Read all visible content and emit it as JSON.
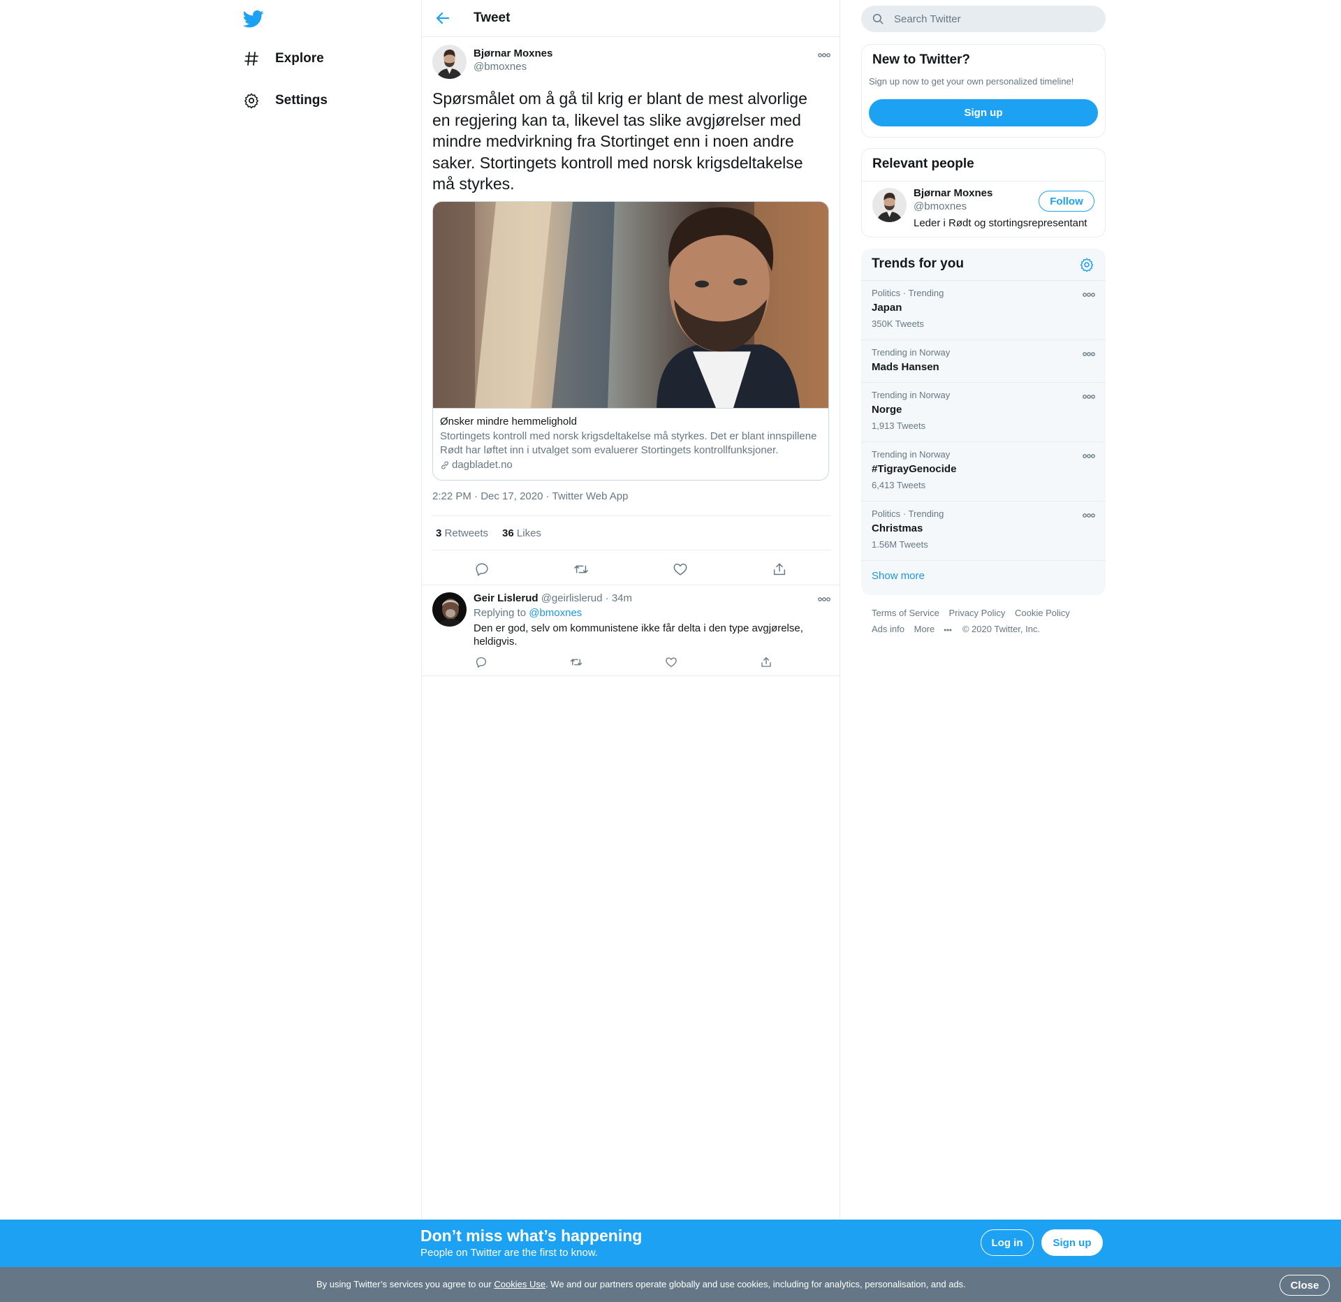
{
  "colors": {
    "brand": "#1da1f2",
    "link": "#1b95e0",
    "text": "#14171a",
    "secondary": "#657786",
    "border": "#e6ecf0",
    "cookie_bar": "#657786"
  },
  "nav": {
    "logo_icon": "twitter-bird-icon",
    "items": [
      {
        "label": "Explore",
        "icon": "hashtag-icon"
      },
      {
        "label": "Settings",
        "icon": "gear-icon"
      }
    ]
  },
  "header": {
    "title": "Tweet",
    "back_icon": "arrow-left-icon"
  },
  "tweet": {
    "author_name": "Bjørnar Moxnes",
    "author_handle": "@bmoxnes",
    "text": "Spørsmålet om å gå til krig er blant de mest alvorlige en regjering kan ta, likevel tas slike avgjørelser med mindre medvirkning fra Stortinget enn i noen andre saker. Stortingets kontroll med norsk krigsdeltakelse må styrkes.",
    "card": {
      "title": "Ønsker mindre hemmelighold",
      "description": "Stortingets kontroll med norsk krigsdeltakelse må styrkes. Det er blant innspillene Rødt har løftet inn i utvalget som evaluerer Stortingets kontrollfunksjoner.",
      "domain": "dagbladet.no"
    },
    "time": "2:22 PM",
    "date": "Dec 17, 2020",
    "source": "Twitter Web App",
    "sep": "·",
    "retweets_count": "3",
    "retweets_label": "Retweets",
    "likes_count": "36",
    "likes_label": "Likes"
  },
  "reply": {
    "author_name": "Geir Lislerud",
    "author_handle": "@geirlislerud",
    "sep": "·",
    "age": "34m",
    "replying_prefix": "Replying to",
    "replying_to": "@bmoxnes",
    "text": "Den er god, selv om kommunistene ikke får delta i den type avgjørelse, heldigvis."
  },
  "search": {
    "placeholder": "Search Twitter"
  },
  "new_to_twitter": {
    "title": "New to Twitter?",
    "subtitle": "Sign up now to get your own personalized timeline!",
    "button": "Sign up"
  },
  "relevant_people": {
    "title": "Relevant people",
    "name": "Bjørnar Moxnes",
    "handle": "@bmoxnes",
    "bio": "Leder i Rødt og stortingsrepresentant",
    "follow": "Follow"
  },
  "trends": {
    "title": "Trends for you",
    "items": [
      {
        "context": "Politics · Trending",
        "name": "Japan",
        "count": "350K Tweets"
      },
      {
        "context": "Trending in Norway",
        "name": "Mads Hansen",
        "count": ""
      },
      {
        "context": "Trending in Norway",
        "name": "Norge",
        "count": "1,913 Tweets"
      },
      {
        "context": "Trending in Norway",
        "name": "#TigrayGenocide",
        "count": "6,413 Tweets"
      },
      {
        "context": "Politics · Trending",
        "name": "Christmas",
        "count": "1.56M Tweets"
      }
    ],
    "show_more": "Show more"
  },
  "footer": {
    "links": [
      "Terms of Service",
      "Privacy Policy",
      "Cookie Policy",
      "Ads info",
      "More"
    ],
    "copyright": "© 2020 Twitter, Inc."
  },
  "promo": {
    "title": "Don’t miss what’s happening",
    "subtitle": "People on Twitter are the first to know.",
    "login": "Log in",
    "signup": "Sign up"
  },
  "cookie": {
    "before": "By using Twitter’s services you agree to our",
    "link": "Cookies Use",
    "after": ". We and our partners operate globally and use cookies, including for analytics, personalisation, and ads.",
    "close": "Close"
  }
}
